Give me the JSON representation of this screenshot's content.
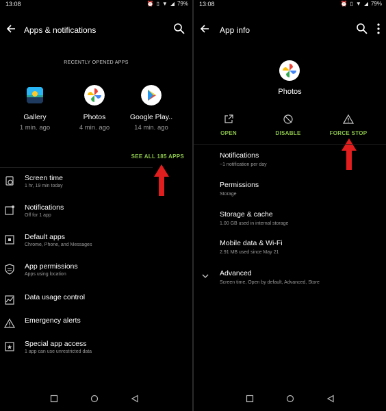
{
  "status": {
    "time": "13:08",
    "battery": "79%"
  },
  "left": {
    "title": "Apps & notifications",
    "section_label": "RECENTLY OPENED APPS",
    "recent_apps": [
      {
        "name": "Gallery",
        "time": "1 min. ago"
      },
      {
        "name": "Photos",
        "time": "4 min. ago"
      },
      {
        "name": "Google Play..",
        "time": "14 min. ago"
      }
    ],
    "see_all": "SEE ALL 185 APPS",
    "items": [
      {
        "title": "Screen time",
        "subtitle": "1 hr, 19 min today"
      },
      {
        "title": "Notifications",
        "subtitle": "Off for 1 app"
      },
      {
        "title": "Default apps",
        "subtitle": "Chrome, Phone, and Messages"
      },
      {
        "title": "App permissions",
        "subtitle": "Apps using location"
      },
      {
        "title": "Data usage control",
        "subtitle": ""
      },
      {
        "title": "Emergency alerts",
        "subtitle": ""
      },
      {
        "title": "Special app access",
        "subtitle": "1 app can use unrestricted data"
      }
    ]
  },
  "right": {
    "title": "App info",
    "app_name": "Photos",
    "actions": [
      {
        "label": "OPEN"
      },
      {
        "label": "DISABLE"
      },
      {
        "label": "FORCE STOP"
      }
    ],
    "items": [
      {
        "title": "Notifications",
        "subtitle": "~1 notification per day"
      },
      {
        "title": "Permissions",
        "subtitle": "Storage"
      },
      {
        "title": "Storage & cache",
        "subtitle": "1.00 GB used in internal storage"
      },
      {
        "title": "Mobile data & Wi-Fi",
        "subtitle": "2.91 MB used since May 21"
      },
      {
        "title": "Advanced",
        "subtitle": "Screen time, Open by default, Advanced, Store"
      }
    ]
  },
  "colors": {
    "accent": "#8bc34a",
    "arrow": "#e01e1e",
    "background": "#000000"
  },
  "icons": [
    "back-arrow-icon",
    "search-icon",
    "more-vert-icon",
    "hourglass-icon",
    "bell-icon",
    "default-apps-icon",
    "shield-icon",
    "data-usage-icon",
    "warning-icon",
    "star-icon",
    "external-link-icon",
    "disable-icon",
    "chevron-down-icon"
  ]
}
